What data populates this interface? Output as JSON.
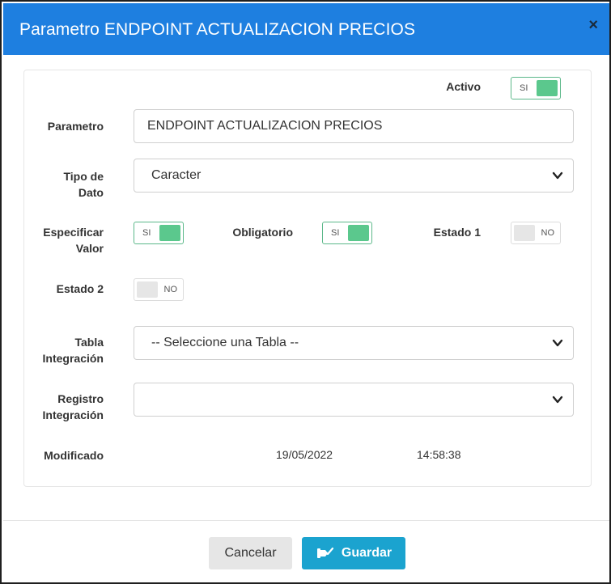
{
  "dialog": {
    "title": "Parametro ENDPOINT ACTUALIZACION PRECIOS",
    "close_glyph": "×"
  },
  "form": {
    "activo": {
      "label": "Activo",
      "toggle_text": "SI",
      "on": true
    },
    "parametro": {
      "label": "Parametro",
      "value": "ENDPOINT ACTUALIZACION PRECIOS"
    },
    "tipo_dato": {
      "label_line1": "Tipo de",
      "label_line2": "Dato",
      "selected": "Caracter"
    },
    "especificar_valor": {
      "label_line1": "Especificar",
      "label_line2": "Valor",
      "toggle_text": "SI",
      "on": true
    },
    "obligatorio": {
      "label": "Obligatorio",
      "toggle_text": "SI",
      "on": true
    },
    "estado1": {
      "label": "Estado 1",
      "toggle_text": "NO",
      "on": false
    },
    "estado2": {
      "label": "Estado 2",
      "toggle_text": "NO",
      "on": false
    },
    "tabla_integracion": {
      "label_line1": "Tabla",
      "label_line2": "Integración",
      "selected": "-- Seleccione una Tabla --"
    },
    "registro_integracion": {
      "label_line1": "Registro",
      "label_line2": "Integración",
      "selected": ""
    },
    "modificado": {
      "label": "Modificado",
      "date": "19/05/2022",
      "time": "14:58:38"
    }
  },
  "footer": {
    "cancel_label": "Cancelar",
    "save_label": "Guardar"
  },
  "colors": {
    "header_bg": "#1e7fe0",
    "toggle_on": "#5bc88d",
    "save_button": "#1ba3cf",
    "cancel_button": "#e6e6e6"
  },
  "icons": {
    "close": "close-icon",
    "chevron": "chevron-down-icon",
    "save": "save-icon"
  }
}
